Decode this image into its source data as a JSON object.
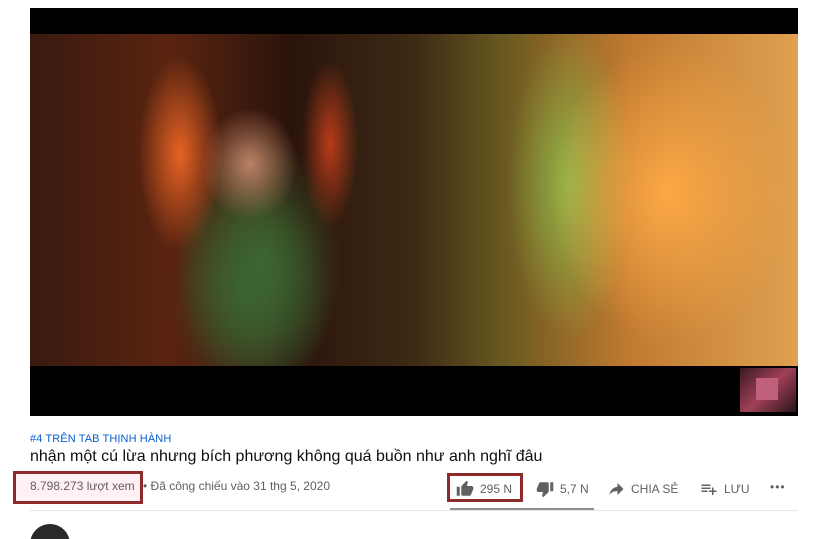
{
  "trend_tag": "#4 TRÊN TAB THỊNH HÀNH",
  "title": "nhận một cú lừa nhưng bích phương không quá buồn như anh nghĩ đâu",
  "views": "8.798.273 lượt xem",
  "date": "• Đã công chiếu vào 31 thg 5, 2020",
  "actions": {
    "like_count": "295 N",
    "dislike_count": "5,7 N",
    "share_label": "CHIA SẺ",
    "save_label": "LƯU",
    "more_label": "•••"
  },
  "icons": {
    "like": "thumbs-up-icon",
    "dislike": "thumbs-down-icon",
    "share": "share-arrow-icon",
    "save": "playlist-add-icon",
    "more": "more-horizontal-icon"
  },
  "colors": {
    "tag_blue": "#065fd4",
    "highlight_border": "#8e2a2a",
    "meta_gray": "#606060"
  },
  "like_ratio": 0.98
}
